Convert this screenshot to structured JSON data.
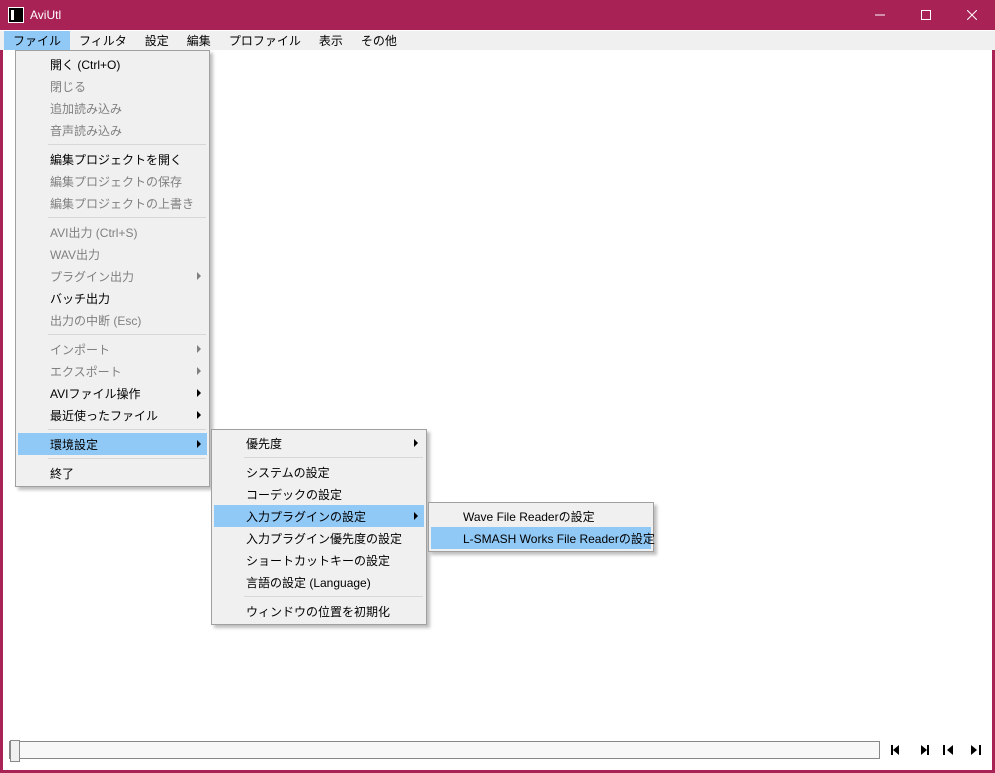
{
  "window": {
    "title": "AviUtl"
  },
  "menubar": {
    "items": [
      {
        "label": "ファイル",
        "active": true
      },
      {
        "label": "フィルタ",
        "active": false
      },
      {
        "label": "設定",
        "active": false
      },
      {
        "label": "編集",
        "active": false
      },
      {
        "label": "プロファイル",
        "active": false
      },
      {
        "label": "表示",
        "active": false
      },
      {
        "label": "その他",
        "active": false
      }
    ]
  },
  "file_menu": {
    "items": [
      {
        "label": "開く (Ctrl+O)",
        "disabled": false,
        "submenu": false
      },
      {
        "label": "閉じる",
        "disabled": true,
        "submenu": false
      },
      {
        "label": "追加読み込み",
        "disabled": true,
        "submenu": false
      },
      {
        "label": "音声読み込み",
        "disabled": true,
        "submenu": false
      },
      {
        "sep": true
      },
      {
        "label": "編集プロジェクトを開く",
        "disabled": false,
        "submenu": false
      },
      {
        "label": "編集プロジェクトの保存",
        "disabled": true,
        "submenu": false
      },
      {
        "label": "編集プロジェクトの上書き",
        "disabled": true,
        "submenu": false
      },
      {
        "sep": true
      },
      {
        "label": "AVI出力 (Ctrl+S)",
        "disabled": true,
        "submenu": false
      },
      {
        "label": "WAV出力",
        "disabled": true,
        "submenu": false
      },
      {
        "label": "プラグイン出力",
        "disabled": true,
        "submenu": true
      },
      {
        "label": "バッチ出力",
        "disabled": false,
        "submenu": false
      },
      {
        "label": "出力の中断 (Esc)",
        "disabled": true,
        "submenu": false
      },
      {
        "sep": true
      },
      {
        "label": "インポート",
        "disabled": true,
        "submenu": true
      },
      {
        "label": "エクスポート",
        "disabled": true,
        "submenu": true
      },
      {
        "label": "AVIファイル操作",
        "disabled": false,
        "submenu": true
      },
      {
        "label": "最近使ったファイル",
        "disabled": false,
        "submenu": true
      },
      {
        "sep": true
      },
      {
        "label": "環境設定",
        "disabled": false,
        "submenu": true,
        "highlight": true
      },
      {
        "sep": true
      },
      {
        "label": "終了",
        "disabled": false,
        "submenu": false
      }
    ]
  },
  "env_menu": {
    "items": [
      {
        "label": "優先度",
        "submenu": true
      },
      {
        "sep": true
      },
      {
        "label": "システムの設定",
        "submenu": false
      },
      {
        "label": "コーデックの設定",
        "submenu": false
      },
      {
        "label": "入力プラグインの設定",
        "submenu": true,
        "highlight": true
      },
      {
        "label": "入力プラグイン優先度の設定",
        "submenu": false
      },
      {
        "label": "ショートカットキーの設定",
        "submenu": false
      },
      {
        "label": "言語の設定 (Language)",
        "submenu": false
      },
      {
        "sep": true
      },
      {
        "label": "ウィンドウの位置を初期化",
        "submenu": false
      }
    ]
  },
  "plugin_menu": {
    "items": [
      {
        "label": "Wave File Readerの設定",
        "highlight": false
      },
      {
        "label": "L-SMASH Works File Readerの設定",
        "highlight": true
      }
    ]
  }
}
